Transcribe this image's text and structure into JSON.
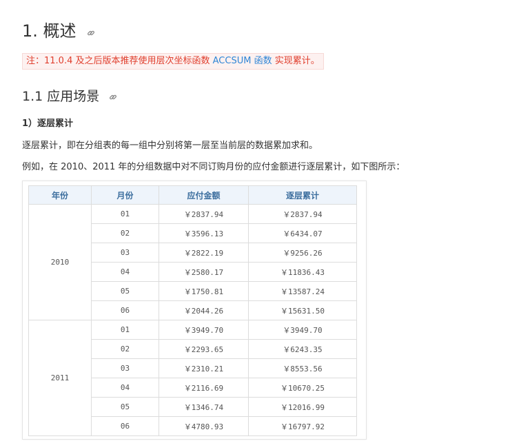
{
  "heading1": "1. 概述",
  "note": {
    "prefix": "注：11.0.4 及之后版本推荐使用层次坐标函数 ",
    "link1": "ACCSUM",
    "middle": " ",
    "link2": "函数",
    "suffix": " 实现累计。"
  },
  "heading2": "1.1 应用场景",
  "heading4": "1）逐层累计",
  "paragraph1": "逐层累计，即在分组表的每一组中分别将第一层至当前层的数据累加求和。",
  "paragraph2": "例如，在 2010、2011 年的分组数据中对不同订购月份的应付金额进行逐层累计，如下图所示：",
  "table": {
    "headers": [
      "年份",
      "月份",
      "应付金额",
      "逐层累计"
    ],
    "groups": [
      {
        "year": "2010",
        "rows": [
          [
            "01",
            "￥2837.94",
            "￥2837.94"
          ],
          [
            "02",
            "￥3596.13",
            "￥6434.07"
          ],
          [
            "03",
            "￥2822.19",
            "￥9256.26"
          ],
          [
            "04",
            "￥2580.17",
            "￥11836.43"
          ],
          [
            "05",
            "￥1750.81",
            "￥13587.24"
          ],
          [
            "06",
            "￥2044.26",
            "￥15631.50"
          ]
        ]
      },
      {
        "year": "2011",
        "rows": [
          [
            "01",
            "￥3949.70",
            "￥3949.70"
          ],
          [
            "02",
            "￥2293.65",
            "￥6243.35"
          ],
          [
            "03",
            "￥2310.21",
            "￥8553.56"
          ],
          [
            "04",
            "￥2116.69",
            "￥10670.25"
          ],
          [
            "05",
            "￥1346.74",
            "￥12016.99"
          ],
          [
            "06",
            "￥4780.93",
            "￥16797.92"
          ]
        ]
      }
    ]
  },
  "icons": {
    "anchor": "link-icon"
  },
  "colors": {
    "note_text": "#e03e2d",
    "note_link": "#2f86d6",
    "table_header_bg": "#eef4fb",
    "table_header_text": "#3c6e9e"
  }
}
